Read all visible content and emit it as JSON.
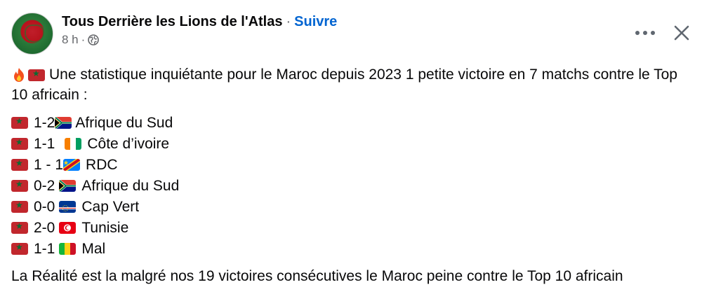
{
  "post": {
    "page_name": "Tous Derrière les Lions de l'Atlas",
    "dot": "·",
    "follow_label": "Suivre",
    "time": "8 h",
    "time_sep": "·",
    "privacy_icon": "globe-icon"
  },
  "actions": {
    "more_icon": "more-options-icon",
    "close_icon": "close-icon"
  },
  "content": {
    "intro": "Une statistique inquiétante pour le Maroc depuis 2023 1 petite victoire en 7 matchs  contre le Top 10 africain :",
    "results": [
      {
        "score": "1-2",
        "opponent": "Afrique du Sud",
        "flag": "south-africa"
      },
      {
        "score": "1-1",
        "opponent": "Côte d’ivoire",
        "flag": "ivory-coast"
      },
      {
        "score": "1 - 1",
        "opponent": "RDC",
        "flag": "dr-congo"
      },
      {
        "score": "0-2",
        "opponent": "Afrique du Sud",
        "flag": "south-africa"
      },
      {
        "score": "0-0",
        "opponent": "Cap Vert",
        "flag": "cape-verde"
      },
      {
        "score": "2-0",
        "opponent": "Tunisie",
        "flag": "tunisia"
      },
      {
        "score": "1-1",
        "opponent": "Mal",
        "flag": "mali"
      }
    ],
    "outro": "La Réalité est la malgré nos 19 victoires consécutives le Maroc peine contre le Top 10 africain"
  }
}
